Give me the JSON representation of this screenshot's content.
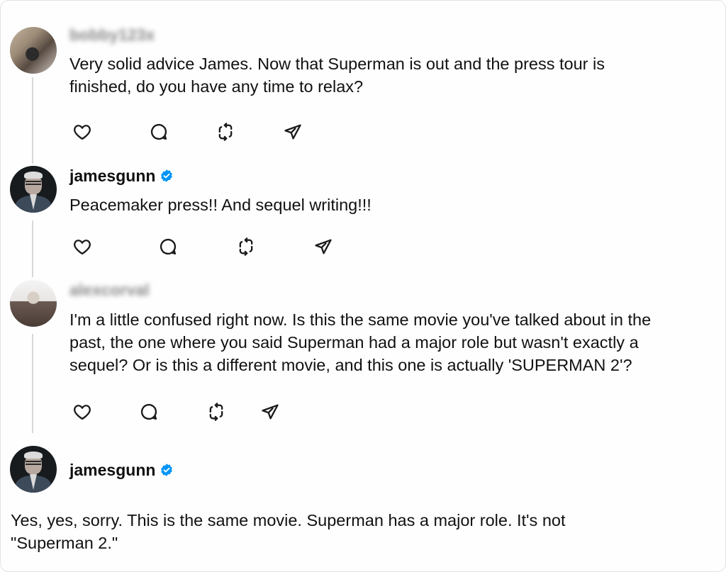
{
  "posts": [
    {
      "username": "bobby123x",
      "verified": false,
      "lines": [
        "Very solid advice James. Now that Superman is out and the press tour is",
        "finished, do you have any time to relax?"
      ]
    },
    {
      "username": "jamesgunn",
      "verified": true,
      "lines": [
        "Peacemaker press!! And sequel writing!!!"
      ]
    },
    {
      "username": "alexcorval",
      "verified": false,
      "lines": [
        "I'm a little confused right now. Is this the same movie you've talked about in the",
        "past, the one where you said Superman had a major role but wasn't exactly a",
        "sequel? Or is this a different movie, and this one is actually 'SUPERMAN 2'?"
      ]
    },
    {
      "username": "jamesgunn",
      "verified": true,
      "lines": [
        "Yes, yes, sorry. This is the same movie. Superman has a major role. It's not",
        "\"Superman 2.\""
      ]
    }
  ],
  "icons": {
    "like": "heart-icon",
    "reply": "comment-icon",
    "repost": "repost-icon",
    "share": "send-icon",
    "verified": "verified-badge-icon"
  },
  "colors": {
    "verified_blue": "#0095f6",
    "thread_line": "#d8d8d8"
  }
}
